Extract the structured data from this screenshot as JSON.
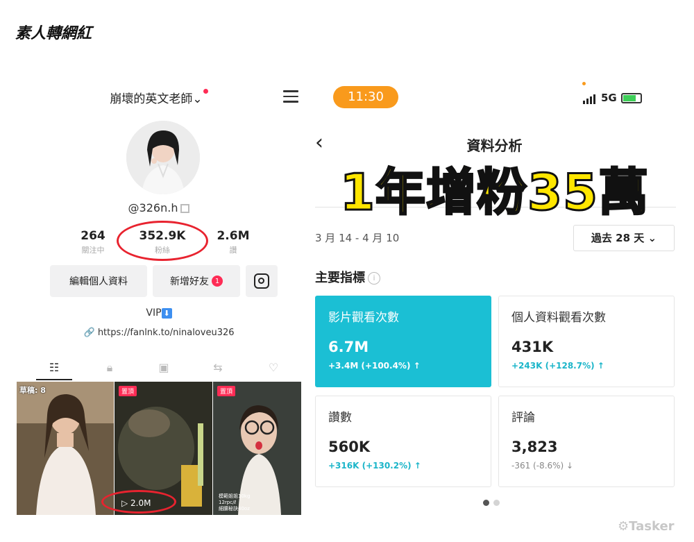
{
  "page_title": "素人轉網紅",
  "profile": {
    "username": "崩壞的英文老師",
    "handle": "@326n.h",
    "stats": [
      {
        "value": "264",
        "label": "關注中"
      },
      {
        "value": "352.9K",
        "label": "粉絲"
      },
      {
        "value": "2.6M",
        "label": "讚"
      }
    ],
    "edit_button": "編輯個人資料",
    "add_friends_button": "新增好友",
    "add_friends_badge": "1",
    "vip": "VIP",
    "vip_icon": "down-arrow-badge",
    "link": "https://fanlnk.to/ninaloveu326",
    "grid": [
      {
        "label": "草稿: 8",
        "pinned": false
      },
      {
        "pin_label": "置頂",
        "views": "2.0M",
        "pinned": true
      },
      {
        "pin_label": "置頂",
        "captions": [
          "模範姐姐10kg",
          "12rpc/ℓ",
          "細腰秘訣40oz"
        ],
        "pinned": true
      }
    ]
  },
  "analytics": {
    "time": "11:30",
    "network": "5G",
    "back": "‹",
    "title": "資料分析",
    "overlay": "1年增粉35萬",
    "date_range": "3 月 14 - 4 月 10",
    "period": "過去 28 天",
    "section_title": "主要指標",
    "info_icon": "i",
    "cards": [
      {
        "label": "影片觀看次數",
        "value": "6.7M",
        "delta": "+3.4M (+100.4%) ↑",
        "active": true
      },
      {
        "label": "個人資料觀看次數",
        "value": "431K",
        "delta": "+243K (+128.7%) ↑",
        "active": false
      },
      {
        "label": "讚數",
        "value": "560K",
        "delta": "+316K (+130.2%) ↑",
        "active": false
      },
      {
        "label": "評論",
        "value": "3,823",
        "delta": "-361 (-8.6%) ↓",
        "active": false
      }
    ]
  },
  "watermark": "Tasker",
  "colors": {
    "accent": "#1bbfd4",
    "highlight": "#e8232f",
    "tiktok_pink": "#fe2c55",
    "time_pill": "#f99a1c",
    "overlay_text": "#ffe600"
  }
}
